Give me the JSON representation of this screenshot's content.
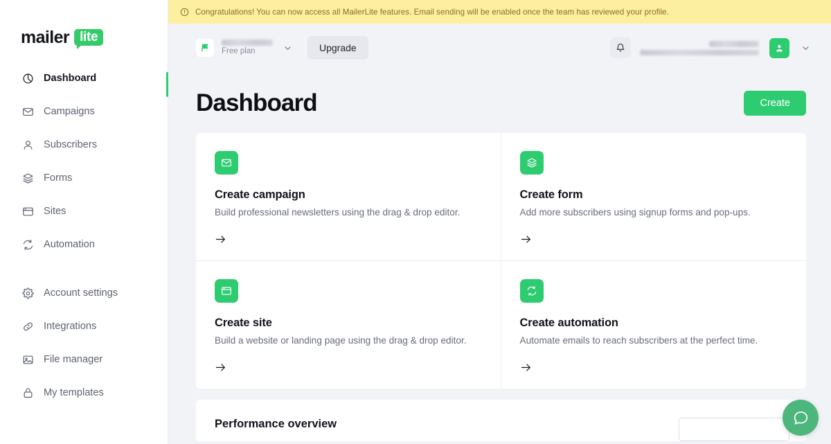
{
  "brand": {
    "logo_primary": "mailer",
    "logo_badge": "lite",
    "green": "#2ecc71",
    "banner_bg": "#fcf0a0",
    "banner_text_color": "#8a6d1f",
    "page_bg": "#f2f3f7"
  },
  "banner": {
    "icon": "alert-circle-icon",
    "message": "Congratulations! You can now access all MailerLite features. Email sending will be enabled once the team has reviewed your profile."
  },
  "sidebar": {
    "groups": [
      {
        "items": [
          {
            "label": "Dashboard",
            "icon": "dashboard-pie-icon",
            "active": true
          },
          {
            "label": "Campaigns",
            "icon": "envelope-icon",
            "active": false
          },
          {
            "label": "Subscribers",
            "icon": "person-icon",
            "active": false
          },
          {
            "label": "Forms",
            "icon": "layers-icon",
            "active": false
          },
          {
            "label": "Sites",
            "icon": "browser-window-icon",
            "active": false
          },
          {
            "label": "Automation",
            "icon": "refresh-icon",
            "active": false
          }
        ]
      },
      {
        "items": [
          {
            "label": "Account settings",
            "icon": "gear-icon",
            "active": false
          },
          {
            "label": "Integrations",
            "icon": "link-icon",
            "active": false
          },
          {
            "label": "File manager",
            "icon": "image-icon",
            "active": false
          },
          {
            "label": "My templates",
            "icon": "briefcase-lock-icon",
            "active": false
          }
        ]
      }
    ]
  },
  "topbar": {
    "account": {
      "name": "",
      "name_redacted": true,
      "plan": "Free plan",
      "flag_icon": "green-flag-icon",
      "chevron_icon": "chevron-down-icon"
    },
    "upgrade_label": "Upgrade",
    "notifications_icon": "bell-icon",
    "user": {
      "name": "",
      "name_redacted": true,
      "email": "",
      "email_redacted": true,
      "avatar_icon": "person-avatar-icon",
      "chevron_icon": "chevron-down-icon"
    }
  },
  "page": {
    "title": "Dashboard",
    "create_label": "Create"
  },
  "quick_actions": [
    {
      "icon": "envelope-icon",
      "title": "Create campaign",
      "description": "Build professional newsletters using the drag & drop editor.",
      "arrow_icon": "arrow-right-icon"
    },
    {
      "icon": "layers-icon",
      "title": "Create form",
      "description": "Add more subscribers using signup forms and pop-ups.",
      "arrow_icon": "arrow-right-icon"
    },
    {
      "icon": "browser-window-icon",
      "title": "Create site",
      "description": "Build a website or landing page using the drag & drop editor.",
      "arrow_icon": "arrow-right-icon"
    },
    {
      "icon": "refresh-icon",
      "title": "Create automation",
      "description": "Automate emails to reach subscribers at the perfect time.",
      "arrow_icon": "arrow-right-icon"
    }
  ],
  "bottom_panel": {
    "title": "Performance overview",
    "range_value": ""
  },
  "help": {
    "icon": "chat-bubble-icon",
    "color": "#4cb67c"
  }
}
